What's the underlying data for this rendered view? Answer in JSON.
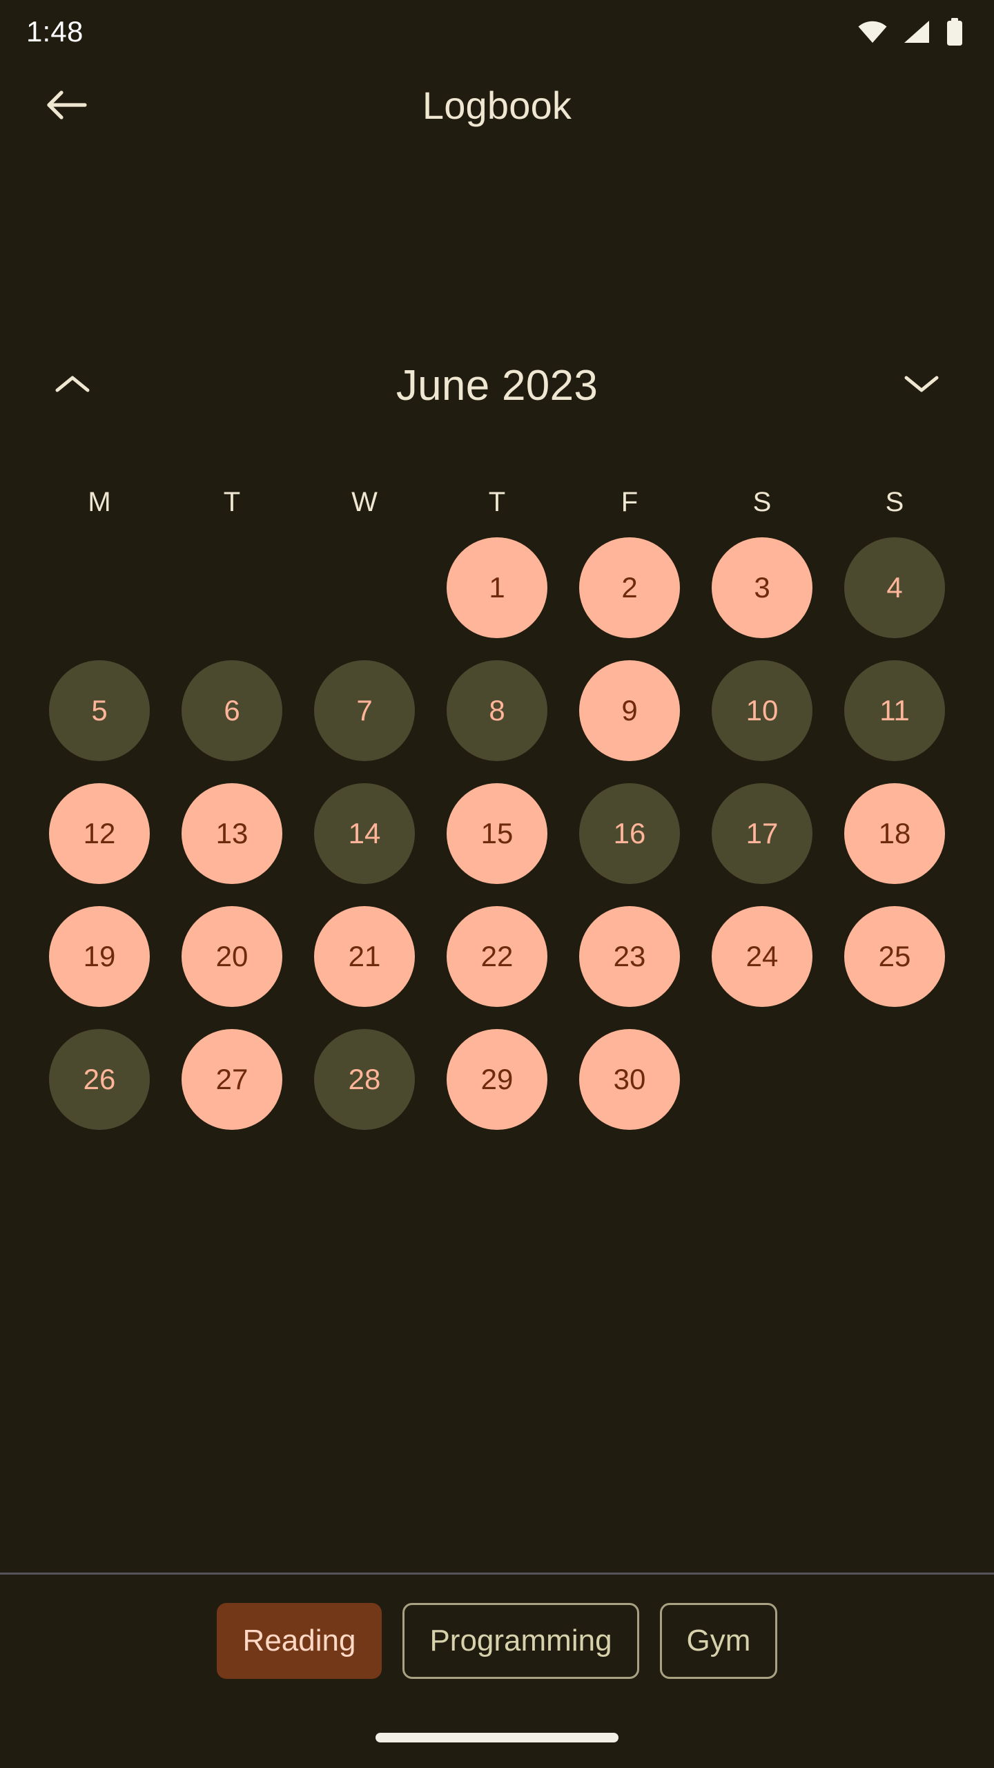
{
  "status_bar": {
    "time": "1:48",
    "icons": [
      "wifi-icon",
      "cellular-signal-icon",
      "battery-icon"
    ]
  },
  "app_bar": {
    "back_icon": "arrow-left-icon",
    "title": "Logbook"
  },
  "month_nav": {
    "prev_icon": "chevron-up-icon",
    "next_icon": "chevron-down-icon",
    "label": "June 2023"
  },
  "calendar": {
    "weekday_headers": [
      "M",
      "T",
      "W",
      "T",
      "F",
      "S",
      "S"
    ],
    "month": "June",
    "year": "2023",
    "first_weekday_index": 3,
    "days_in_month": 30,
    "completed_days": [
      1,
      2,
      3,
      9,
      12,
      13,
      15,
      18,
      19,
      20,
      21,
      22,
      23,
      24,
      25,
      27,
      29,
      30
    ],
    "weeks": [
      [
        {
          "label": "",
          "state": "empty"
        },
        {
          "label": "",
          "state": "empty"
        },
        {
          "label": "",
          "state": "empty"
        },
        {
          "label": "1",
          "state": "done"
        },
        {
          "label": "2",
          "state": "done"
        },
        {
          "label": "3",
          "state": "done"
        },
        {
          "label": "4",
          "state": "todo"
        }
      ],
      [
        {
          "label": "5",
          "state": "todo"
        },
        {
          "label": "6",
          "state": "todo"
        },
        {
          "label": "7",
          "state": "todo"
        },
        {
          "label": "8",
          "state": "todo"
        },
        {
          "label": "9",
          "state": "done"
        },
        {
          "label": "10",
          "state": "todo"
        },
        {
          "label": "11",
          "state": "todo"
        }
      ],
      [
        {
          "label": "12",
          "state": "done"
        },
        {
          "label": "13",
          "state": "done"
        },
        {
          "label": "14",
          "state": "todo"
        },
        {
          "label": "15",
          "state": "done"
        },
        {
          "label": "16",
          "state": "todo"
        },
        {
          "label": "17",
          "state": "todo"
        },
        {
          "label": "18",
          "state": "done"
        }
      ],
      [
        {
          "label": "19",
          "state": "done"
        },
        {
          "label": "20",
          "state": "done"
        },
        {
          "label": "21",
          "state": "done"
        },
        {
          "label": "22",
          "state": "done"
        },
        {
          "label": "23",
          "state": "done"
        },
        {
          "label": "24",
          "state": "done"
        },
        {
          "label": "25",
          "state": "done"
        }
      ],
      [
        {
          "label": "26",
          "state": "todo"
        },
        {
          "label": "27",
          "state": "done"
        },
        {
          "label": "28",
          "state": "todo"
        },
        {
          "label": "29",
          "state": "done"
        },
        {
          "label": "30",
          "state": "done"
        },
        {
          "label": "",
          "state": "empty"
        },
        {
          "label": "",
          "state": "empty"
        }
      ]
    ]
  },
  "habit_filters": {
    "selected": "Reading",
    "chips": [
      {
        "label": "Reading",
        "selected": true
      },
      {
        "label": "Programming",
        "selected": false
      },
      {
        "label": "Gym",
        "selected": false
      }
    ]
  },
  "colors": {
    "background": "#211C10",
    "on_background": "#EFE7D2",
    "day_completed_bg": "#FFB59A",
    "day_completed_text": "#6E2B0B",
    "day_pending_bg": "#4C4A2E",
    "day_pending_text": "#FFB59A",
    "chip_selected_bg": "#733818",
    "chip_selected_text": "#FFD8C6",
    "chip_outline": "#A8A283",
    "chip_text": "#D7D2AC",
    "divider": "#55525C",
    "nav_pill": "#F2EFE6",
    "status_text": "#FFFFFF"
  }
}
